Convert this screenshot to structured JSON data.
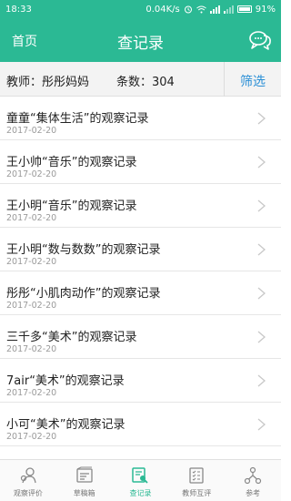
{
  "status": {
    "time": "18:33",
    "speed": "0.04K/s",
    "battery": "91%"
  },
  "header": {
    "back_label": "首页",
    "title": "查记录",
    "chat_icon": "chat-bubbles-icon"
  },
  "filter": {
    "teacher": "教师：彤彤妈妈",
    "count": "条数：304",
    "filter_label": "筛选"
  },
  "records": [
    {
      "title": "童童“集体生活”的观察记录",
      "date": "2017-02-20"
    },
    {
      "title": "王小帅“音乐”的观察记录",
      "date": "2017-02-20"
    },
    {
      "title": "王小明“音乐”的观察记录",
      "date": "2017-02-20"
    },
    {
      "title": "王小明“数与数数”的观察记录",
      "date": "2017-02-20"
    },
    {
      "title": "彤彤“小肌肉动作”的观察记录",
      "date": "2017-02-20"
    },
    {
      "title": "三千多“美术”的观察记录",
      "date": "2017-02-20"
    },
    {
      "title": "7air“美术”的观察记录",
      "date": "2017-02-20"
    },
    {
      "title": "小可“美术”的观察记录",
      "date": "2017-02-20"
    }
  ],
  "tabs": [
    {
      "label": "观察评价",
      "icon": "observe-icon",
      "active": false
    },
    {
      "label": "草稿箱",
      "icon": "drafts-icon",
      "active": false
    },
    {
      "label": "查记录",
      "icon": "records-search-icon",
      "active": true
    },
    {
      "label": "教师互评",
      "icon": "peer-review-icon",
      "active": false
    },
    {
      "label": "参考",
      "icon": "reference-icon",
      "active": false
    }
  ],
  "colors": {
    "accent": "#2bb994",
    "link": "#2a8fd6"
  }
}
